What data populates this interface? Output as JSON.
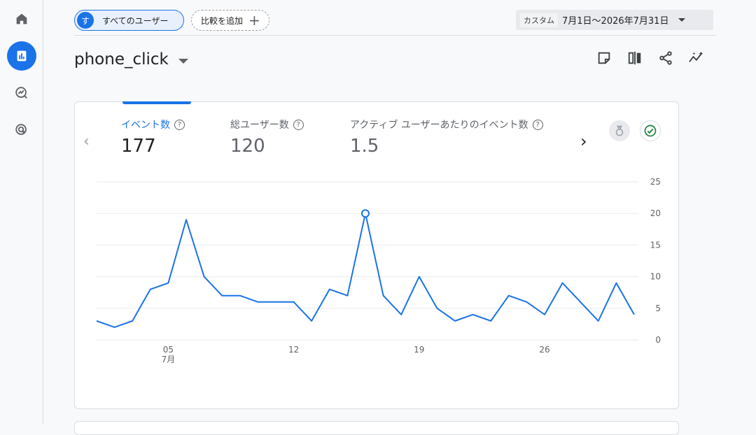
{
  "nav": {
    "items": [
      {
        "name": "home",
        "icon": "home-icon"
      },
      {
        "name": "reports",
        "icon": "bar-chart-icon",
        "active": true
      },
      {
        "name": "explore",
        "icon": "explore-icon"
      },
      {
        "name": "advertising",
        "icon": "ads-icon"
      }
    ]
  },
  "topbar": {
    "segment_avatar": "す",
    "segment_label": "すべてのユーザー",
    "compare_label": "比較を追加",
    "date_tag": "カスタム",
    "date_range": "7月1日〜2026年7月31日"
  },
  "page": {
    "title": "phone_click"
  },
  "metrics": [
    {
      "label": "イベント数",
      "value": "177",
      "selected": true
    },
    {
      "label": "総ユーザー数",
      "value": "120"
    },
    {
      "label": "アクティブ ユーザーあたりのイベント数",
      "value": "1.5"
    }
  ],
  "colors": {
    "accent": "#1a73e8",
    "line": "#1a73e8",
    "success": "#188038"
  },
  "chart_data": {
    "type": "line",
    "x": [
      "07-01",
      "07-02",
      "07-03",
      "07-04",
      "07-05",
      "07-06",
      "07-07",
      "07-08",
      "07-09",
      "07-10",
      "07-11",
      "07-12",
      "07-13",
      "07-14",
      "07-15",
      "07-16",
      "07-17",
      "07-18",
      "07-19",
      "07-20",
      "07-21",
      "07-22",
      "07-23",
      "07-24",
      "07-25",
      "07-26",
      "07-27",
      "07-28",
      "07-29",
      "07-30",
      "07-31"
    ],
    "series": [
      {
        "values": [
          3,
          2,
          3,
          8,
          9,
          19,
          10,
          7,
          7,
          6,
          6,
          6,
          3,
          8,
          7,
          20,
          7,
          4,
          10,
          5,
          3,
          4,
          3,
          7,
          6,
          4,
          9,
          6,
          3,
          9,
          4
        ]
      }
    ],
    "highlight_index": 15,
    "ylim": [
      0,
      25
    ],
    "yticks": [
      "0",
      "5",
      "10",
      "15",
      "20",
      "25"
    ],
    "xticks": [
      {
        "index": 4,
        "label": "05",
        "sub": "7月"
      },
      {
        "index": 11,
        "label": "12",
        "sub": ""
      },
      {
        "index": 18,
        "label": "19",
        "sub": ""
      },
      {
        "index": 25,
        "label": "26",
        "sub": ""
      }
    ],
    "grid": true,
    "axis_side": "right"
  }
}
